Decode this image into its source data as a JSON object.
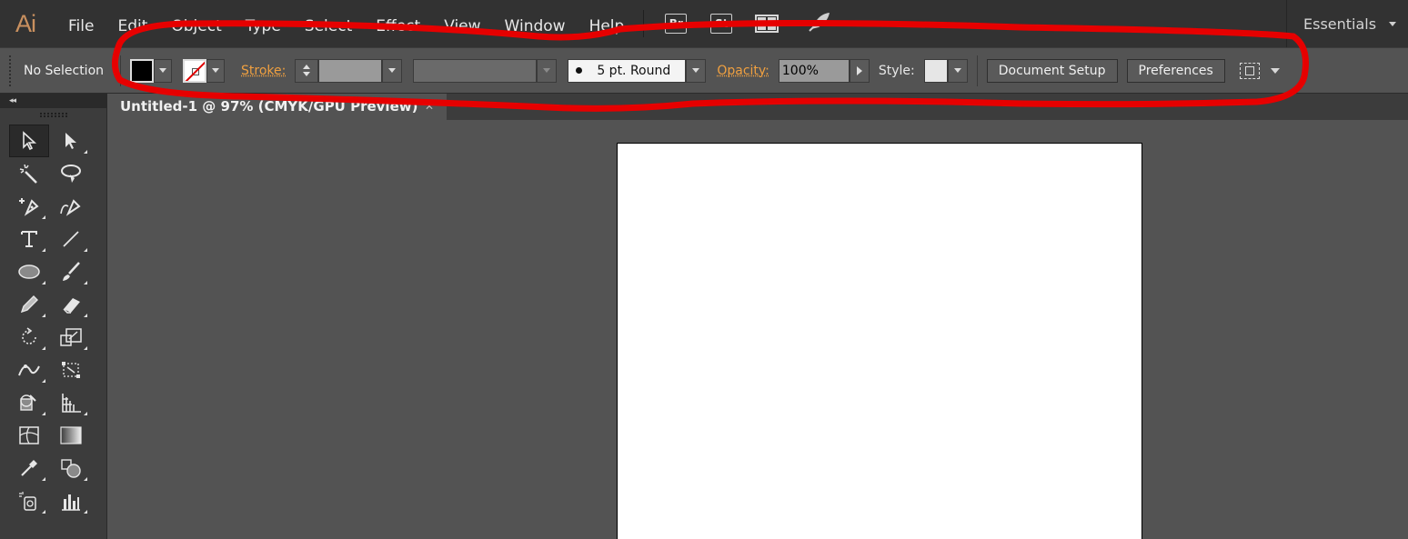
{
  "app": {
    "logo": "Ai"
  },
  "menu": {
    "items": [
      "File",
      "Edit",
      "Object",
      "Type",
      "Select",
      "Effect",
      "View",
      "Window",
      "Help"
    ]
  },
  "badges": {
    "bridge": "Br",
    "stock": "St"
  },
  "workspace": {
    "label": "Essentials"
  },
  "control": {
    "selection": "No Selection",
    "stroke_label": "Stroke:",
    "brush": "5 pt. Round",
    "opacity_label": "Opacity:",
    "opacity_value": "100%",
    "style_label": "Style:",
    "document_setup": "Document Setup",
    "preferences": "Preferences"
  },
  "document": {
    "tab_title": "Untitled-1 @ 97% (CMYK/GPU Preview)"
  },
  "icons": {
    "fill": "fill-swatch-icon",
    "stroke": "stroke-none-icon",
    "arrange": "arrange-documents-icon",
    "gpu": "rocket-icon",
    "transform": "transform-icon"
  },
  "colors": {
    "accent": "#f0a040",
    "annotation": "#e60000",
    "logo": "#c9905f"
  }
}
